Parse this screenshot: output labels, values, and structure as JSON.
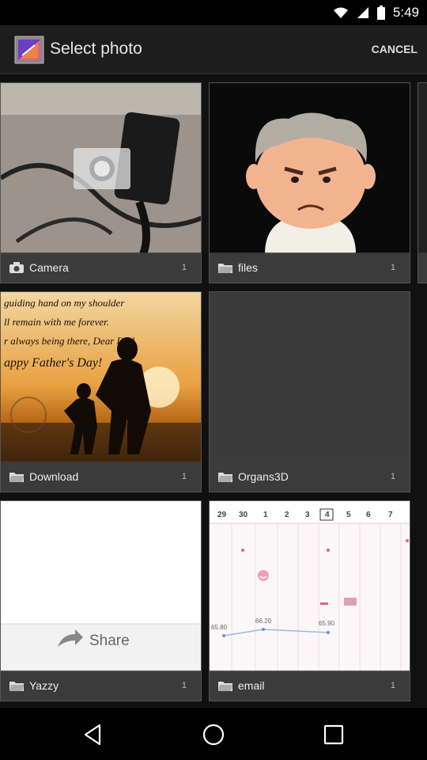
{
  "status_bar": {
    "time": "5:49"
  },
  "header": {
    "title": "Select photo",
    "cancel_label": "CANCEL"
  },
  "albums": [
    {
      "name": "Camera",
      "count": "1",
      "icon": "camera-icon"
    },
    {
      "name": "files",
      "count": "1",
      "icon": "folder-icon"
    },
    {
      "name": "Download",
      "count": "1",
      "icon": "folder-icon"
    },
    {
      "name": "Organs3D",
      "count": "1",
      "icon": "folder-icon"
    },
    {
      "name": "Yazzy",
      "count": "1",
      "icon": "folder-icon"
    },
    {
      "name": "email",
      "count": "1",
      "icon": "folder-icon"
    }
  ],
  "thumb_text": {
    "fathers_lines": [
      "guiding hand on my shoulder",
      "ll remain with me forever.",
      "r always being there, Dear Dad.",
      "appy Father's Day!"
    ],
    "share_label": "Share",
    "calendar_days": [
      "29",
      "30",
      "1",
      "2",
      "3",
      "4",
      "5",
      "6",
      "7"
    ],
    "calendar_values": [
      "65.80",
      "66.20",
      "65.90"
    ]
  },
  "colors": {
    "background": "#000000",
    "action_bar": "#1d1d1d",
    "caption": "#3c3c3c",
    "calendar_accent": "#e0608a"
  }
}
